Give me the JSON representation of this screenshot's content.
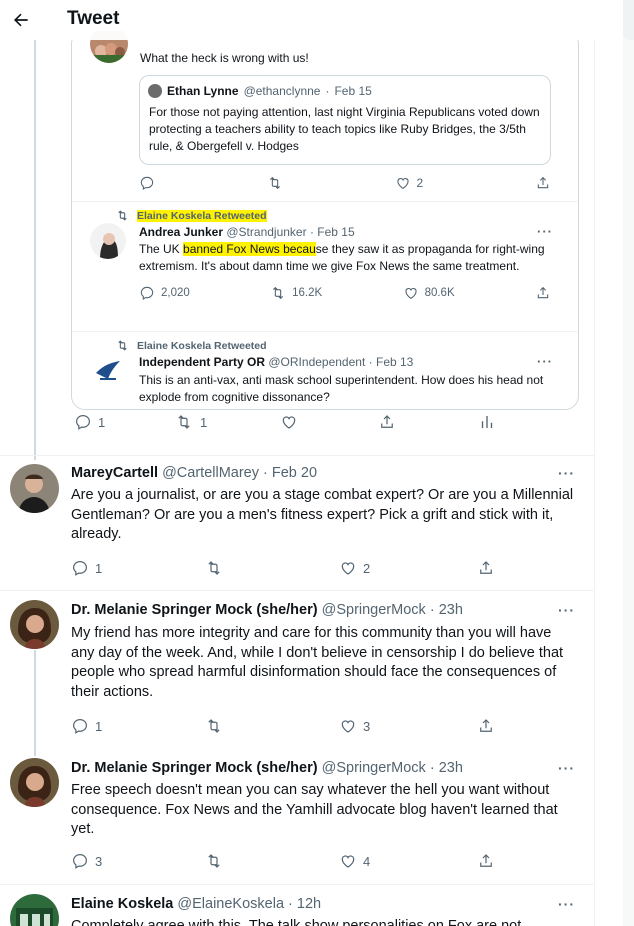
{
  "header": {
    "title": "Tweet"
  },
  "embed": {
    "top_reply": {
      "text": "What the heck is wrong with us!"
    },
    "inner_quote": {
      "name": "Ethan Lynne",
      "handle": "@ethanclynne",
      "sep": "·",
      "date": "Feb 15",
      "text": "For those not paying attention, last night Virginia Republicans voted down protecting a teachers ability to teach topics like Ruby Bridges, the 3/5th rule, & Obergefell v. Hodges"
    },
    "top_actions": {
      "reply": "",
      "retweet": "",
      "like": "2"
    },
    "retweet1": {
      "label": "Elaine Koskela Retweeted",
      "name": "Andrea Junker",
      "handle": "@Strandjunker",
      "sep": "·",
      "date": "Feb 15",
      "text_a": "The UK ",
      "text_hl1": "banned Fox News becau",
      "text_b": "se they saw it as propaganda for right-wing extremism. It's about damn time we give Fox News the same treatment.",
      "replies": "2,020",
      "retweets": "16.2K",
      "likes": "80.6K"
    },
    "retweet2": {
      "label": "Elaine Koskela Retweeted",
      "name": "Independent Party OR",
      "handle": "@ORIndependent",
      "sep": "·",
      "date": "Feb 13",
      "text": "This is an anti-vax, anti mask school superintendent. How does his head not explode from cognitive dissonance?"
    },
    "more": "···"
  },
  "main_actions": {
    "replies": "1",
    "retweets": "1"
  },
  "replies": [
    {
      "name": "MareyCartell",
      "handle": "@CartellMarey",
      "sep": "·",
      "date": "Feb 20",
      "text": "Are you a journalist, or are you a stage combat expert? Or are you a Millennial Gentleman? Or are you a men's fitness expert? Pick a grift and stick with it, already.",
      "replies": "1",
      "retweets": "",
      "likes": "2",
      "more": "···"
    },
    {
      "name": "Dr. Melanie Springer Mock (she/her)",
      "handle": "@SpringerMock",
      "sep": "·",
      "date": "23h",
      "text": "My friend has more integrity and care for this community than you will have any day of the week. And, while I don't believe in censorship I do believe that people who spread harmful disinformation should face the consequences of their actions.",
      "replies": "1",
      "retweets": "",
      "likes": "3",
      "more": "···"
    },
    {
      "name": "Dr. Melanie Springer Mock (she/her)",
      "handle": "@SpringerMock",
      "sep": "·",
      "date": "23h",
      "text": "Free speech doesn't mean you can say whatever the hell you want without consequence. Fox News and the Yamhill advocate blog haven't learned that yet.",
      "replies": "3",
      "retweets": "",
      "likes": "4",
      "more": "···"
    },
    {
      "name": "Elaine Koskela",
      "handle": "@ElaineKoskela",
      "sep": "·",
      "date": "12h",
      "text": "Completely agree with this. The talk show personalities on Fox are not",
      "more": "···"
    }
  ]
}
